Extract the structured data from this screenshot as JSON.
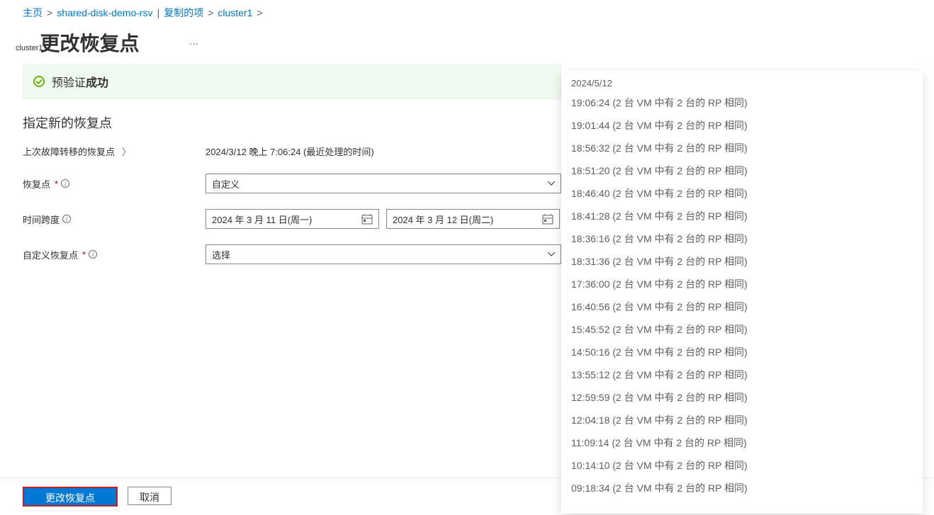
{
  "breadcrumb": {
    "home": "主页",
    "item1": "shared-disk-demo-rsv",
    "item1_suffix": "复制的项",
    "item2": "cluster1"
  },
  "page": {
    "subtitle_small": "cluster1",
    "title": "更改恢复点",
    "ellipsis": "…"
  },
  "status": {
    "prefix": "预验证",
    "bold": "成功"
  },
  "section": {
    "heading": "指定新的恢复点"
  },
  "form": {
    "last_failover_label": "上次故障转移的恢复点",
    "last_failover_value": "2024/3/12 晚上 7:06:24 (最近处理的时间)",
    "recovery_point_label": "恢复点",
    "recovery_point_value": "自定义",
    "time_span_label": "时间跨度",
    "date_start": "2024 年 3 月 11 日(周一)",
    "date_end": "2024 年 3 月 12 日(周二)",
    "custom_recovery_label": "自定义恢复点",
    "custom_recovery_value": "选择",
    "required_star": "*",
    "info_icon": "i",
    "paren_icon": "〉"
  },
  "footer": {
    "primary": "更改恢复点",
    "secondary": "取消"
  },
  "dropdown": {
    "date_header": "2024/5/12",
    "items": [
      "19:06:24 (2 台 VM 中有 2 台的 RP 相同)",
      "19:01:44 (2 台 VM 中有 2 台的 RP 相同)",
      "18:56:32 (2 台 VM 中有 2 台的 RP 相同)",
      "18:51:20 (2 台 VM 中有 2 台的 RP 相同)",
      "18:46:40 (2 台 VM 中有 2 台的 RP 相同)",
      "18:41:28 (2 台 VM 中有 2 台的 RP 相同)",
      "18:36:16 (2 台 VM 中有 2 台的 RP 相同)",
      "18:31:36 (2 台 VM 中有 2 台的 RP 相同)",
      "17:36:00 (2 台 VM 中有 2 台的 RP 相同)",
      "16:40:56 (2 台 VM 中有 2 台的 RP 相同)",
      "15:45:52 (2 台 VM 中有 2 台的 RP 相同)",
      "14:50:16 (2 台 VM 中有 2 台的 RP 相同)",
      "13:55:12 (2 台 VM 中有 2 台的 RP 相同)",
      "12:59:59 (2 台 VM 中有 2 台的 RP 相同)",
      "12:04:18 (2 台 VM 中有 2 台的 RP 相同)",
      "11:09:14 (2 台 VM 中有 2 台的 RP 相同)",
      "10:14:10 (2 台 VM 中有 2 台的 RP 相同)",
      "09:18:34 (2 台 VM 中有 2 台的 RP 相同)"
    ]
  }
}
